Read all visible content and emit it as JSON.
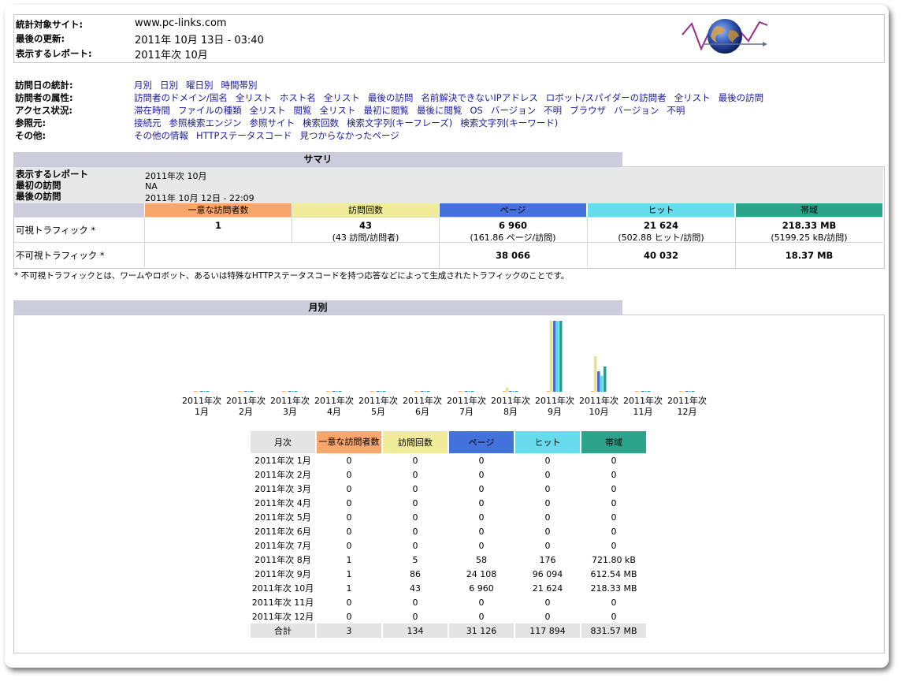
{
  "header": {
    "site_label": "統計対象サイト:",
    "site_value": "www.pc-links.com",
    "updated_label": "最後の更新:",
    "updated_value": "2011年 10月 13日 - 03:40",
    "report_label": "表示するレポート:",
    "report_value": "2011年次 10月"
  },
  "nav": [
    {
      "label": "訪問日の統計:",
      "links": [
        "月別",
        "日別",
        "曜日別",
        "時間帯別"
      ]
    },
    {
      "label": "訪問者の属性:",
      "links": [
        "訪問者のドメイン/国名",
        "全リスト",
        "ホスト名",
        "全リスト",
        "最後の訪問",
        "名前解決できないIPアドレス",
        "ロボット/スパイダーの訪問者",
        "全リスト",
        "最後の訪問"
      ]
    },
    {
      "label": "アクセス状況:",
      "links": [
        "滞在時間",
        "ファイルの種類",
        "全リスト",
        "閲覧",
        "全リスト",
        "最初に閲覧",
        "最後に閲覧",
        "OS",
        "バージョン",
        "不明",
        "ブラウザ",
        "バージョン",
        "不明"
      ]
    },
    {
      "label": "参照元:",
      "links": [
        "接続元",
        "参照検索エンジン",
        "参照サイト",
        "検索回数",
        "検索文字列(キーフレーズ)",
        "検索文字列(キーワード)"
      ]
    },
    {
      "label": "その他:",
      "links": [
        "その他の情報",
        "HTTPステータスコード",
        "見つからなかったページ"
      ]
    }
  ],
  "summary": {
    "title": "サマリ",
    "report_label": "表示するレポート",
    "report_value": "2011年次 10月",
    "first_label": "最初の訪問",
    "first_value": "NA",
    "last_label": "最後の訪問",
    "last_value": "2011年 10月 12日 - 22:09",
    "columns": [
      "一意な訪問者数",
      "訪問回数",
      "ページ",
      "ヒット",
      "帯域"
    ],
    "visible_label": "可視トラフィック *",
    "visible": {
      "unique": "1",
      "visits": "43",
      "visits_sub": "(43 訪問/訪問者)",
      "pages": "6 960",
      "pages_sub": "(161.86 ページ/訪問)",
      "hits": "21 624",
      "hits_sub": "(502.88 ヒット/訪問)",
      "bandwidth": "218.33 MB",
      "bandwidth_sub": "(5199.25 kB/訪問)"
    },
    "invisible_label": "不可視トラフィック *",
    "invisible": {
      "pages": "38 066",
      "hits": "40 032",
      "bandwidth": "18.37 MB"
    },
    "note": "* 不可視トラフィックとは、ワームやロボット、あるいは特殊なHTTPステータスコードを持つ応答などによって生成されたトラフィックのことです。"
  },
  "monthly": {
    "title": "月別",
    "columns": [
      "月次",
      "一意な訪問者数",
      "訪問回数",
      "ページ",
      "ヒット",
      "帯域"
    ],
    "rows": [
      [
        "2011年次 1月",
        "0",
        "0",
        "0",
        "0",
        "0"
      ],
      [
        "2011年次 2月",
        "0",
        "0",
        "0",
        "0",
        "0"
      ],
      [
        "2011年次 3月",
        "0",
        "0",
        "0",
        "0",
        "0"
      ],
      [
        "2011年次 4月",
        "0",
        "0",
        "0",
        "0",
        "0"
      ],
      [
        "2011年次 5月",
        "0",
        "0",
        "0",
        "0",
        "0"
      ],
      [
        "2011年次 6月",
        "0",
        "0",
        "0",
        "0",
        "0"
      ],
      [
        "2011年次 7月",
        "0",
        "0",
        "0",
        "0",
        "0"
      ],
      [
        "2011年次 8月",
        "1",
        "5",
        "58",
        "176",
        "721.80 kB"
      ],
      [
        "2011年次 9月",
        "1",
        "86",
        "24 108",
        "96 094",
        "612.54 MB"
      ],
      [
        "2011年次 10月",
        "1",
        "43",
        "6 960",
        "21 624",
        "218.33 MB"
      ],
      [
        "2011年次 11月",
        "0",
        "0",
        "0",
        "0",
        "0"
      ],
      [
        "2011年次 12月",
        "0",
        "0",
        "0",
        "0",
        "0"
      ]
    ],
    "total": [
      "合計",
      "3",
      "134",
      "31 126",
      "117 894",
      "831.57 MB"
    ]
  },
  "chart_data": {
    "type": "bar",
    "categories": [
      "2011年次 1月",
      "2011年次 2月",
      "2011年次 3月",
      "2011年次 4月",
      "2011年次 5月",
      "2011年次 6月",
      "2011年次 7月",
      "2011年次 8月",
      "2011年次 9月",
      "2011年次 10月",
      "2011年次 11月",
      "2011年次 12月"
    ],
    "series": [
      {
        "name": "一意な訪問者数",
        "values": [
          0,
          0,
          0,
          0,
          0,
          0,
          0,
          1,
          1,
          1,
          0,
          0
        ]
      },
      {
        "name": "訪問回数",
        "values": [
          0,
          0,
          0,
          0,
          0,
          0,
          0,
          5,
          86,
          43,
          0,
          0
        ]
      },
      {
        "name": "ページ",
        "values": [
          0,
          0,
          0,
          0,
          0,
          0,
          0,
          58,
          24108,
          6960,
          0,
          0
        ]
      },
      {
        "name": "ヒット",
        "values": [
          0,
          0,
          0,
          0,
          0,
          0,
          0,
          176,
          96094,
          21624,
          0,
          0
        ]
      },
      {
        "name": "帯域",
        "values": [
          0,
          0,
          0,
          0,
          0,
          0,
          0,
          0.705,
          612.54,
          218.33,
          0,
          0
        ]
      }
    ],
    "colors": [
      "#f5a36c",
      "#e8e09a",
      "#4a6ed8",
      "#63d8ec",
      "#2aa08c"
    ],
    "legend": "none"
  },
  "colors": {
    "unique": "#f9a66c",
    "visits": "#f0ec9a",
    "pages": "#4472dc",
    "hits": "#66dcee",
    "bandwidth": "#2ca48c",
    "section": "#ccccdd",
    "link": "#1a1a9e"
  }
}
